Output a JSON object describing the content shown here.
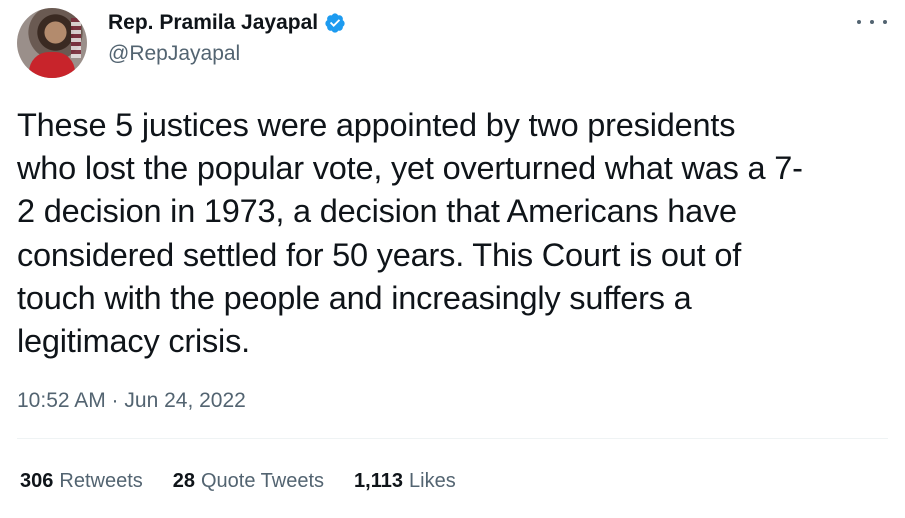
{
  "author": {
    "name": "Rep. Pramila Jayapal",
    "handle": "@RepJayapal",
    "verified": true
  },
  "tweet": {
    "lines": [
      "These 5 justices were appointed by two presidents",
      "who lost the popular vote, yet overturned what was a 7-",
      "2 decision in 1973, a decision that Americans have",
      "considered settled for 50 years. This Court is out of",
      "touch with the people and increasingly suffers a",
      "legitimacy crisis."
    ],
    "timestamp": "10:52 AM · Jun 24, 2022"
  },
  "stats": {
    "retweets_count": "306",
    "retweets_label": "Retweets",
    "quotes_count": "28",
    "quotes_label": "Quote Tweets",
    "likes_count": "1,113",
    "likes_label": "Likes"
  },
  "icons": {
    "verified": "verified-badge-icon",
    "more": "more-options-icon"
  },
  "colors": {
    "verified_blue": "#1d9bf0",
    "secondary_text": "#536471",
    "primary_text": "#0f1419"
  }
}
